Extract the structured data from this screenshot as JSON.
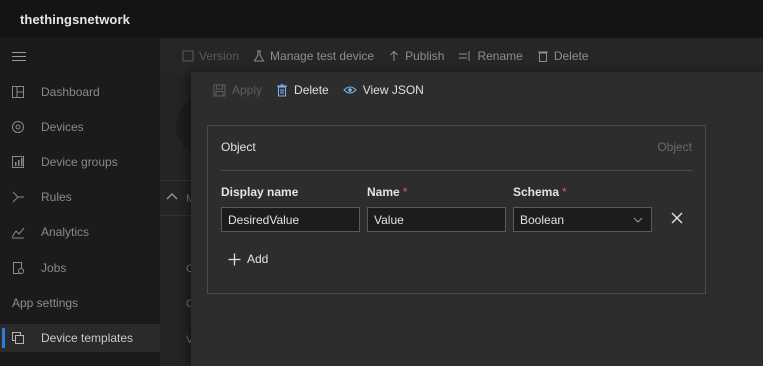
{
  "app": {
    "brand": "thethingsnetwork"
  },
  "sidebar": {
    "items": [
      {
        "label": "Dashboard",
        "icon": "dashboard-icon"
      },
      {
        "label": "Devices",
        "icon": "devices-icon"
      },
      {
        "label": "Device groups",
        "icon": "device-groups-icon"
      },
      {
        "label": "Rules",
        "icon": "rules-icon"
      },
      {
        "label": "Analytics",
        "icon": "analytics-icon"
      },
      {
        "label": "Jobs",
        "icon": "jobs-icon"
      }
    ],
    "section": "App settings",
    "active_item": {
      "label": "Device templates",
      "icon": "device-templates-icon"
    }
  },
  "background_toolbar": {
    "version": "Version",
    "manage_test_device": "Manage test device",
    "publish": "Publish",
    "rename": "Rename",
    "delete": "Delete"
  },
  "background_letters": [
    "M",
    "C",
    "C",
    "V"
  ],
  "panel": {
    "toolbar": {
      "apply": "Apply",
      "delete": "Delete",
      "view_json": "View JSON"
    },
    "object": {
      "title": "Object",
      "type": "Object",
      "columns": {
        "display_name": "Display name",
        "name": "Name",
        "schema": "Schema",
        "required_mark": "*"
      },
      "field": {
        "display_name": "DesiredValue",
        "name": "Value",
        "schema": "Boolean"
      },
      "add_label": "Add"
    }
  },
  "colors": {
    "accent": "#2f7fd8",
    "required": "#e05a5a",
    "panel_bg": "#2d2d2d"
  }
}
